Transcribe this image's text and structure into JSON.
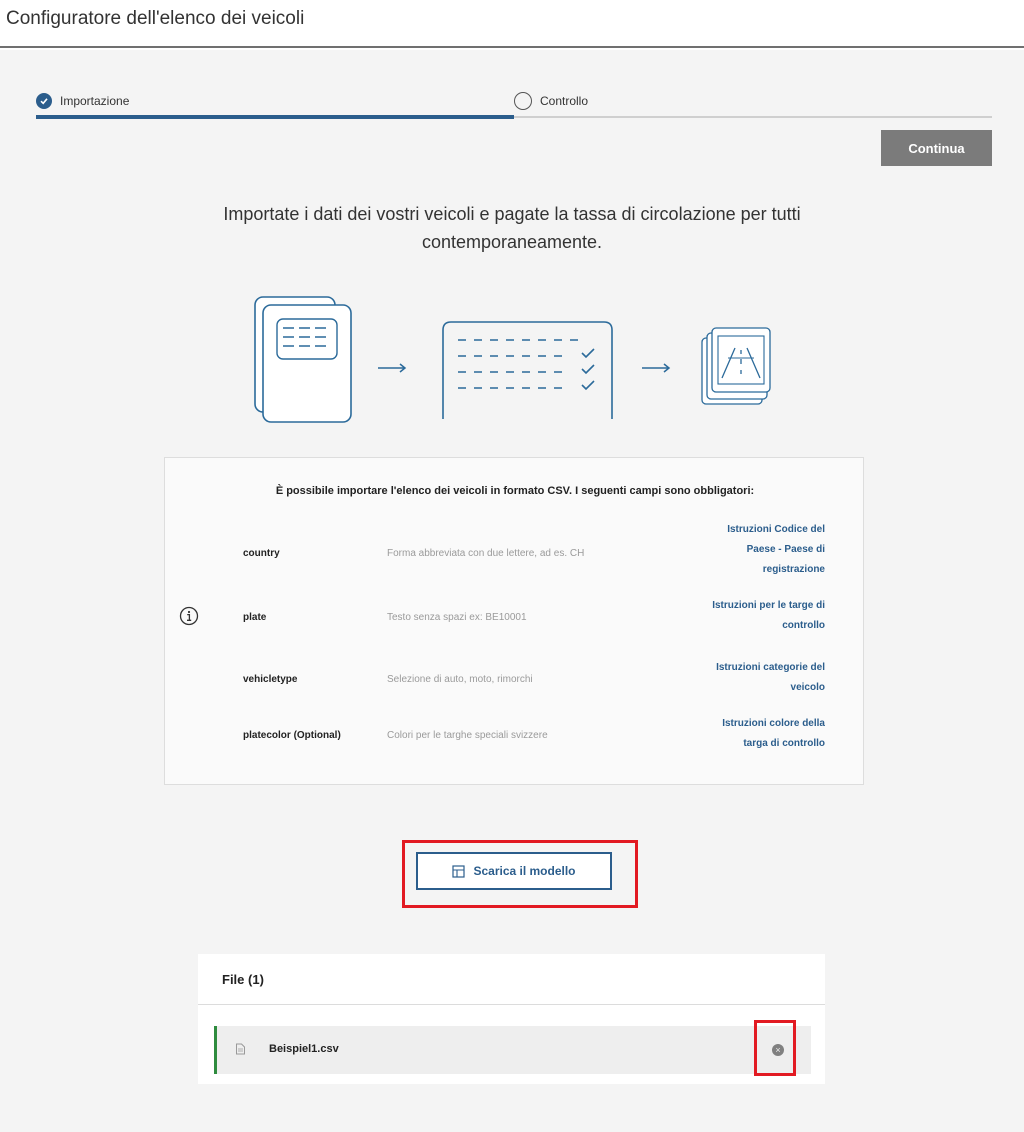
{
  "header": {
    "title": "Configuratore dell'elenco dei veicoli"
  },
  "stepper": {
    "steps": [
      {
        "label": "Importazione",
        "state": "done"
      },
      {
        "label": "Controllo",
        "state": "pending"
      }
    ]
  },
  "actions": {
    "continue_label": "Continua"
  },
  "intro": {
    "text": "Importate i dati dei vostri veicoli e pagate la tassa di circolazione per tutti contemporaneamente."
  },
  "info": {
    "heading": "È possibile importare l'elenco dei veicoli in formato CSV. I seguenti campi sono obbligatori:",
    "fields": [
      {
        "name": "country",
        "description": "Forma abbreviata con due lettere, ad es. CH",
        "link_line1": "Istruzioni Codice del",
        "link_line2": "Paese - Paese di",
        "link_line3": "registrazione"
      },
      {
        "name": "plate",
        "description": "Testo senza spazi ex: BE10001",
        "link_line1": "Istruzioni per le targe di",
        "link_line2": "controllo"
      },
      {
        "name": "vehicletype",
        "description": "Selezione di auto, moto, rimorchi",
        "link_line1": "Istruzioni categorie del",
        "link_line2": "veicolo"
      },
      {
        "name": "platecolor (Optional)",
        "description": "Colori per le targhe speciali svizzere",
        "link_line1": "Istruzioni colore della",
        "link_line2": "targa di controllo"
      }
    ]
  },
  "template": {
    "download_label": "Scarica il modello"
  },
  "files": {
    "title": "File (1)",
    "items": [
      {
        "name": "Beispiel1.csv"
      }
    ]
  },
  "colors": {
    "accent": "#2b5d8c",
    "highlight": "#e21a22",
    "success_bar": "#2e8b3e",
    "disabled_button": "#7b7b7b"
  }
}
